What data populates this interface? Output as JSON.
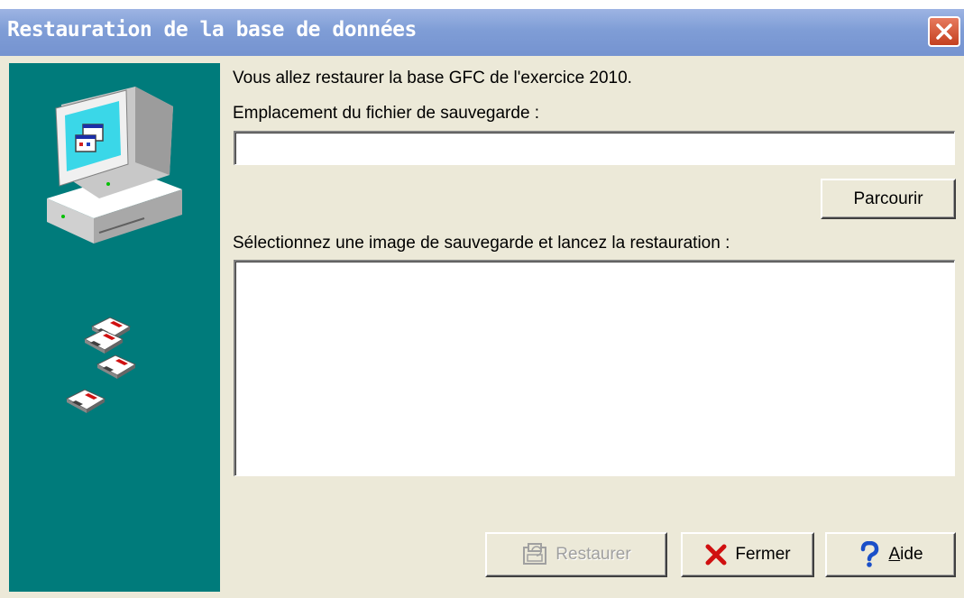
{
  "window": {
    "title": "Restauration de la base de données"
  },
  "main": {
    "info_text": "Vous allez restaurer la base GFC de l'exercice 2010.",
    "location_label": "Emplacement du fichier de sauvegarde :",
    "location_value": "",
    "select_label": "Sélectionnez une image de sauvegarde et lancez la restauration :",
    "backup_images": []
  },
  "buttons": {
    "browse": "Parcourir",
    "restore": "Restaurer",
    "close": "Fermer",
    "help_mnemonic": "A",
    "help_rest": "ide"
  },
  "icons": {
    "title_close": "close-icon",
    "computer": "computer-icon",
    "floppies": "floppy-disk-icon",
    "restore": "restore-icon",
    "close": "red-x-icon",
    "help": "question-mark-icon"
  },
  "colors": {
    "title_bar": "#7f9dd6",
    "left_panel": "#007b7b",
    "dialog_bg": "#ece9d8",
    "close_button": "#c4401f",
    "help_icon": "#1a4fc8"
  }
}
